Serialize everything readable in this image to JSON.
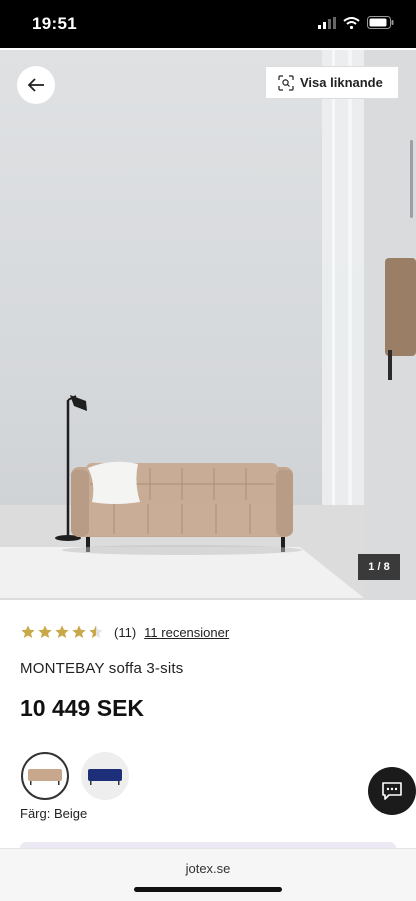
{
  "status_bar": {
    "time": "19:51"
  },
  "hero": {
    "image_counter": "1 / 8"
  },
  "similar_button": {
    "label": "Visa liknande"
  },
  "rating": {
    "score": 4.5,
    "count": "(11)",
    "reviews_link": "11 recensioner"
  },
  "product": {
    "name": "MONTEBAY soffa 3-sits",
    "price": "10 449 SEK"
  },
  "colors": {
    "label": "Färg: Beige",
    "options": [
      {
        "name": "Beige",
        "swatch": "#c7a88c",
        "selected": true
      },
      {
        "name": "Blue",
        "swatch": "#1e2f7a",
        "selected": false
      }
    ]
  },
  "browser": {
    "url": "jotex.se"
  },
  "icons": [
    "back-arrow-icon",
    "visual-search-icon",
    "star-icon",
    "chat-icon",
    "signal-icon",
    "wifi-icon",
    "battery-icon"
  ],
  "colors_theme": {
    "star": "#c9a84a",
    "dark": "#1b1b1b"
  }
}
